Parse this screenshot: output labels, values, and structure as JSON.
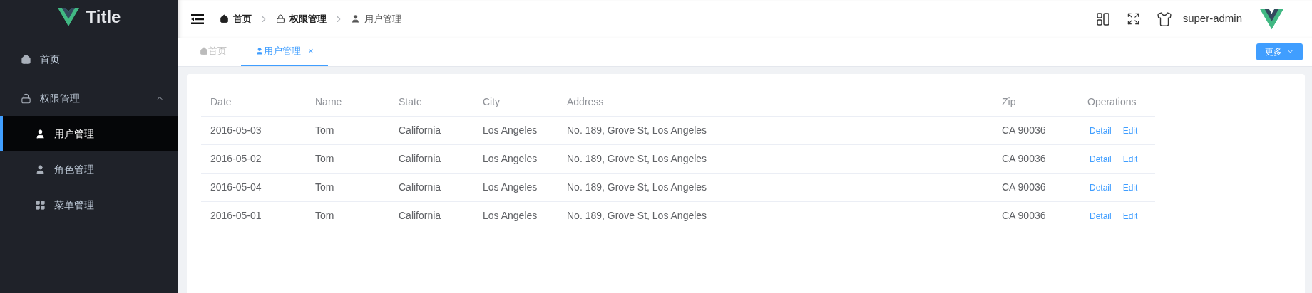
{
  "sidebar": {
    "title": "Title",
    "items": [
      {
        "label": "首页",
        "kind": "home",
        "selected": false
      },
      {
        "label": "权限管理",
        "kind": "lock",
        "expanded": true,
        "selected": false,
        "children": [
          {
            "label": "用户管理",
            "kind": "user",
            "selected": true
          },
          {
            "label": "角色管理",
            "kind": "user",
            "selected": false
          },
          {
            "label": "菜单管理",
            "kind": "grid",
            "selected": false
          }
        ]
      }
    ]
  },
  "breadcrumb": [
    {
      "label": "首页",
      "kind": "home",
      "current": false
    },
    {
      "label": "权限管理",
      "kind": "lock",
      "current": false
    },
    {
      "label": "用户管理",
      "kind": "user",
      "current": true
    }
  ],
  "user": {
    "name": "super-admin"
  },
  "tabs": [
    {
      "label": "首页",
      "kind": "home",
      "selected": false,
      "closable": false
    },
    {
      "label": "用户管理",
      "kind": "user",
      "selected": true,
      "closable": true
    }
  ],
  "tabs_close_mark": "×",
  "more_button": "更多",
  "table": {
    "columns": [
      "Date",
      "Name",
      "State",
      "City",
      "Address",
      "Zip",
      "Operations"
    ],
    "rows": [
      {
        "cells": [
          "2016-05-03",
          "Tom",
          "California",
          "Los Angeles",
          "No. 189, Grove St, Los Angeles",
          "CA 90036"
        ],
        "actions": [
          "Detail",
          "Edit"
        ]
      },
      {
        "cells": [
          "2016-05-02",
          "Tom",
          "California",
          "Los Angeles",
          "No. 189, Grove St, Los Angeles",
          "CA 90036"
        ],
        "actions": [
          "Detail",
          "Edit"
        ]
      },
      {
        "cells": [
          "2016-05-04",
          "Tom",
          "California",
          "Los Angeles",
          "No. 189, Grove St, Los Angeles",
          "CA 90036"
        ],
        "actions": [
          "Detail",
          "Edit"
        ]
      },
      {
        "cells": [
          "2016-05-01",
          "Tom",
          "California",
          "Los Angeles",
          "No. 189, Grove St, Los Angeles",
          "CA 90036"
        ],
        "actions": [
          "Detail",
          "Edit"
        ]
      }
    ]
  }
}
